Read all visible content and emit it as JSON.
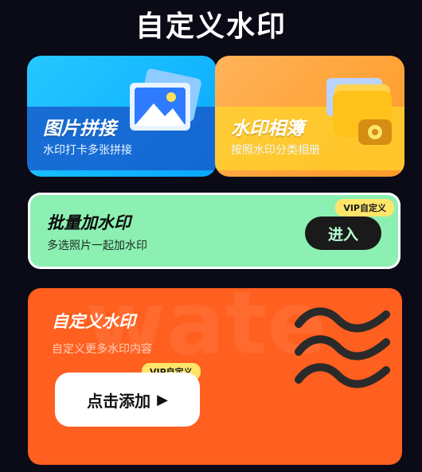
{
  "header": {
    "title": "自定义水印"
  },
  "cards": [
    {
      "label": "图片拼接",
      "subtitle": "水印打卡多张拼接",
      "icon": "photo-icon",
      "color": "#14b8ff"
    },
    {
      "label": "水印相簿",
      "subtitle": "按照水印分类相册",
      "icon": "folder-camera-icon",
      "color": "#ffa43a"
    }
  ],
  "batch": {
    "title": "批量加水印",
    "subtitle": "多选照片一起加水印",
    "button": "进入",
    "badge": "VIP自定义",
    "color": "#8cf0b2"
  },
  "custom": {
    "bg_text": "wate",
    "title": "自定义水印",
    "subtitle": "自定义更多水印内容",
    "button": "点击添加",
    "badge": "VIP自定义",
    "color": "#ff5f1f"
  }
}
